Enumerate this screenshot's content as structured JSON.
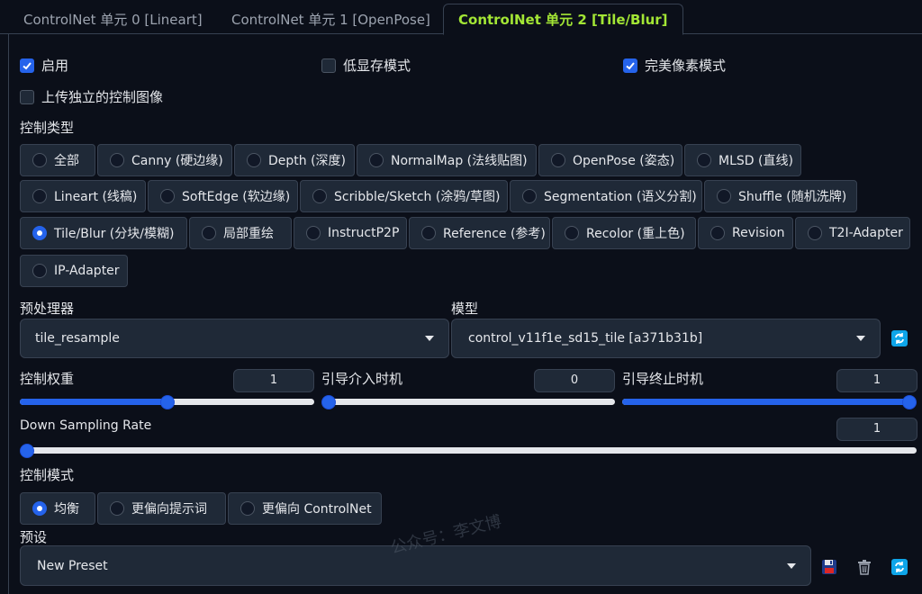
{
  "tabs": [
    {
      "label": "ControlNet 单元 0 [Lineart]",
      "active": false
    },
    {
      "label": "ControlNet 单元 1 [OpenPose]",
      "active": false
    },
    {
      "label": "ControlNet 单元 2 [Tile/Blur]",
      "active": true
    }
  ],
  "checkboxes": {
    "enable": {
      "label": "启用",
      "checked": true
    },
    "low_vram": {
      "label": "低显存模式",
      "checked": false
    },
    "pixel_perfect": {
      "label": "完美像素模式",
      "checked": true
    },
    "upload_independent": {
      "label": "上传独立的控制图像",
      "checked": false
    }
  },
  "control_type": {
    "label": "控制类型",
    "options": [
      "全部",
      "Canny (硬边缘)",
      "Depth (深度)",
      "NormalMap (法线贴图)",
      "OpenPose (姿态)",
      "MLSD (直线)",
      "Lineart (线稿)",
      "SoftEdge (软边缘)",
      "Scribble/Sketch (涂鸦/草图)",
      "Segmentation (语义分割)",
      "Shuffle (随机洗牌)",
      "Tile/Blur (分块/模糊)",
      "局部重绘",
      "InstructP2P",
      "Reference (参考)",
      "Recolor (重上色)",
      "Revision",
      "T2I-Adapter",
      "IP-Adapter"
    ],
    "selected": "Tile/Blur (分块/模糊)"
  },
  "preprocessor": {
    "label": "预处理器",
    "value": "tile_resample"
  },
  "model": {
    "label": "模型",
    "value": "control_v11f1e_sd15_tile [a371b31b]"
  },
  "sliders": {
    "control_weight": {
      "label": "控制权重",
      "value": "1",
      "fraction": 0.5
    },
    "guidance_start": {
      "label": "引导介入时机",
      "value": "0",
      "fraction": 0.0
    },
    "guidance_end": {
      "label": "引导终止时机",
      "value": "1",
      "fraction": 1.0
    },
    "down_sampling": {
      "label": "Down Sampling Rate",
      "value": "1",
      "fraction": 0.0
    }
  },
  "control_mode": {
    "label": "控制模式",
    "options": [
      "均衡",
      "更偏向提示词",
      "更偏向 ControlNet"
    ],
    "selected": "均衡"
  },
  "preset": {
    "label": "预设",
    "value": "New Preset"
  },
  "icons": {
    "refresh": "refresh-icon",
    "save": "save-icon",
    "delete": "trash-icon"
  },
  "watermark": "公众号：李文博",
  "colors": {
    "accent": "#2563eb",
    "active_tab": "#a3e635",
    "background": "#0b0f19",
    "surface": "#1f2937"
  }
}
